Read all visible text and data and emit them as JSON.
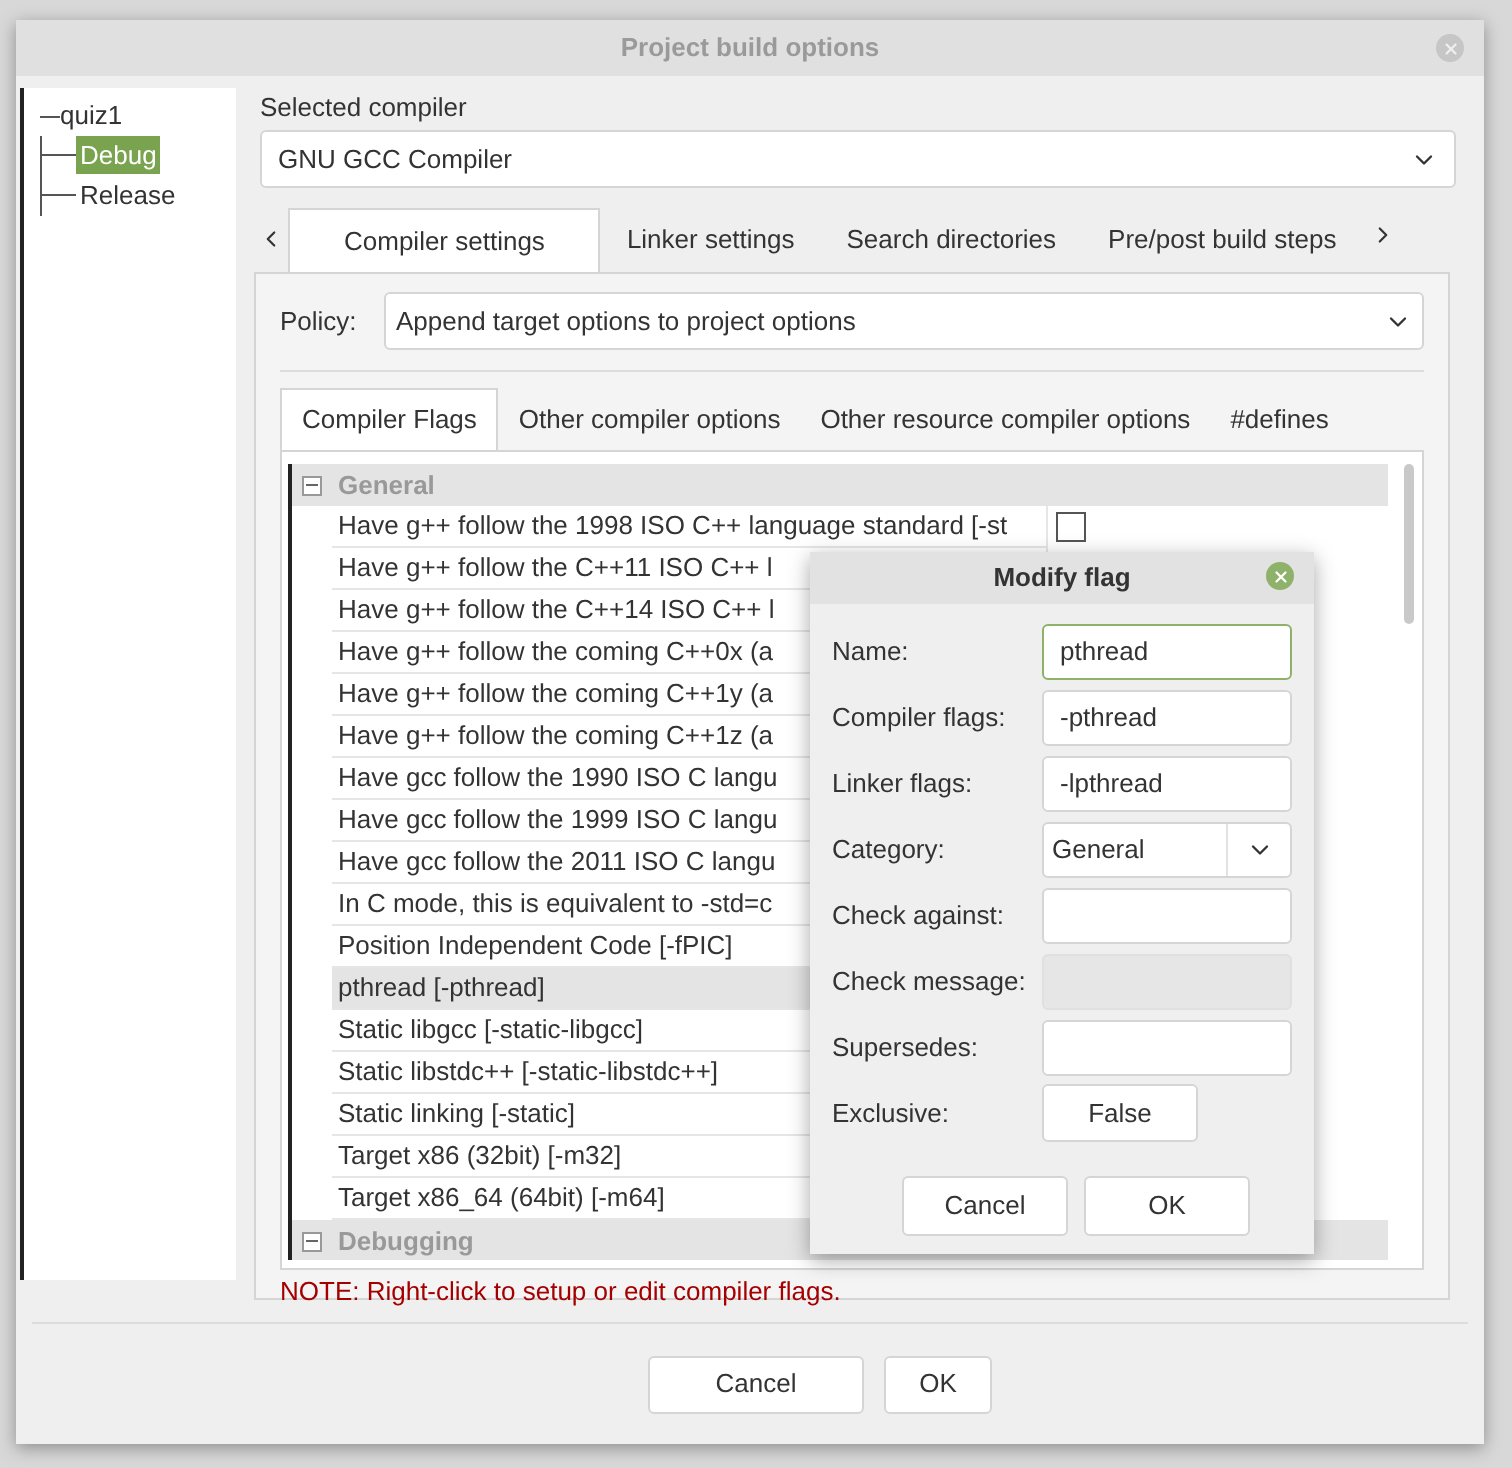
{
  "window": {
    "title": "Project build options"
  },
  "tree": {
    "label": "quiz1",
    "children": [
      {
        "label": "Debug",
        "selected": true
      },
      {
        "label": "Release",
        "selected": false
      }
    ]
  },
  "selected_compiler": {
    "label": "Selected compiler",
    "value": "GNU GCC Compiler"
  },
  "tabs": [
    {
      "label": "Compiler settings",
      "selected": true
    },
    {
      "label": "Linker settings",
      "selected": false
    },
    {
      "label": "Search directories",
      "selected": false
    },
    {
      "label": "Pre/post build steps",
      "selected": false
    }
  ],
  "policy": {
    "label": "Policy:",
    "value": "Append target options to project options"
  },
  "inner_tabs": [
    {
      "label": "Compiler Flags",
      "selected": true
    },
    {
      "label": "Other compiler options",
      "selected": false
    },
    {
      "label": "Other resource compiler options",
      "selected": false
    },
    {
      "label": "#defines",
      "selected": false
    }
  ],
  "flags": [
    {
      "kind": "category",
      "label": "General",
      "expanded": true
    },
    {
      "kind": "flag",
      "label": "Have g++ follow the 1998 ISO C++ language standard  [-st",
      "checked": false,
      "selected": false
    },
    {
      "kind": "flag",
      "label": "Have g++ follow the C++11 ISO C++ l",
      "selected": false
    },
    {
      "kind": "flag",
      "label": "Have g++ follow the C++14 ISO C++ l",
      "selected": false
    },
    {
      "kind": "flag",
      "label": "Have g++ follow the coming C++0x (a",
      "selected": false
    },
    {
      "kind": "flag",
      "label": "Have g++ follow the coming C++1y (a",
      "selected": false
    },
    {
      "kind": "flag",
      "label": "Have g++ follow the coming C++1z (a",
      "selected": false
    },
    {
      "kind": "flag",
      "label": "Have gcc follow the 1990 ISO C langu",
      "selected": false
    },
    {
      "kind": "flag",
      "label": "Have gcc follow the 1999 ISO C langu",
      "selected": false
    },
    {
      "kind": "flag",
      "label": "Have gcc follow the 2011 ISO C langu",
      "selected": false
    },
    {
      "kind": "flag",
      "label": "In C mode, this is equivalent to -std=c",
      "selected": false
    },
    {
      "kind": "flag",
      "label": "Position Independent Code  [-fPIC]",
      "selected": false
    },
    {
      "kind": "flag",
      "label": "pthread  [-pthread]",
      "selected": true
    },
    {
      "kind": "flag",
      "label": "Static libgcc  [-static-libgcc]",
      "selected": false
    },
    {
      "kind": "flag",
      "label": "Static libstdc++  [-static-libstdc++]",
      "selected": false
    },
    {
      "kind": "flag",
      "label": "Static linking  [-static]",
      "selected": false
    },
    {
      "kind": "flag",
      "label": "Target x86 (32bit)  [-m32]",
      "selected": false
    },
    {
      "kind": "flag",
      "label": "Target x86_64 (64bit)  [-m64]",
      "selected": false
    },
    {
      "kind": "category",
      "label": "Debugging",
      "expanded": true
    }
  ],
  "note": "NOTE: Right-click to setup or edit compiler flags.",
  "buttons": [
    "Cancel",
    "OK"
  ],
  "modify_flag": {
    "title": "Modify flag",
    "fields": [
      {
        "kind": "text",
        "label": "Name:",
        "value": "pthread",
        "focused": true,
        "disabled": false
      },
      {
        "kind": "text",
        "label": "Compiler flags:",
        "value": "-pthread",
        "focused": false,
        "disabled": false
      },
      {
        "kind": "text",
        "label": "Linker flags:",
        "value": "-lpthread",
        "focused": false,
        "disabled": false
      },
      {
        "kind": "select",
        "label": "Category:",
        "value": "General"
      },
      {
        "kind": "text",
        "label": "Check against:",
        "focused": false,
        "disabled": false
      },
      {
        "kind": "text",
        "label": "Check message:",
        "focused": false,
        "disabled": true
      },
      {
        "kind": "text",
        "label": "Supersedes:",
        "focused": false,
        "disabled": false
      },
      {
        "kind": "toggle",
        "label": "Exclusive:",
        "value": "False"
      }
    ],
    "buttons": [
      "Cancel",
      "OK"
    ]
  }
}
